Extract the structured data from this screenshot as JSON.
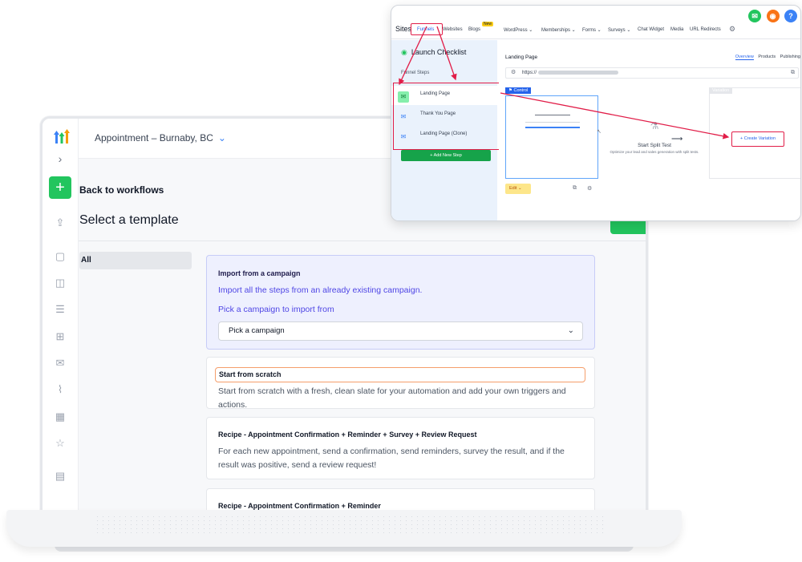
{
  "app": {
    "location": "Appointment – Burnaby, BC",
    "back_link": "Back to workflows",
    "page_title": "Select a template",
    "filter_selected": "All"
  },
  "cards": {
    "import": {
      "title": "Import from a campaign",
      "desc": "Import all the steps from an already existing campaign.",
      "pick_label": "Pick a campaign to import from",
      "select_value": "Pick a campaign"
    },
    "scratch": {
      "title": "Start from scratch",
      "desc": "Start from scratch with a fresh, clean slate for your automation and add your own triggers and actions."
    },
    "recipe1": {
      "title": "Recipe - Appointment Confirmation + Reminder + Survey + Review Request",
      "desc": "For each new appointment, send a confirmation, send reminders, survey the result, and if the result was positive, send a review request!"
    },
    "recipe2": {
      "title": "Recipe - Appointment Confirmation + Reminder"
    }
  },
  "funnels_window": {
    "nav": {
      "sites": "Sites",
      "items": [
        "Funnels",
        "Websites",
        "Blogs",
        "WordPress ⌄",
        "Memberships ⌄",
        "Forms ⌄",
        "Surveys ⌄",
        "Chat Widget",
        "Media",
        "URL Redirects"
      ],
      "new_badge": "New"
    },
    "launch_checklist": "Launch Checklist",
    "funnel_steps_label": "Funnel Steps",
    "steps": [
      "Landing Page",
      "Thank You Page",
      "Landing Page (Clone)"
    ],
    "add_step": "+ Add New Step",
    "page_title": "Landing Page",
    "tabs": [
      "Overview",
      "Products",
      "Publishing"
    ],
    "url": "https://",
    "control_label": "Control",
    "variation_label": "Variation",
    "edit_label": "Edit",
    "split_title": "Start Split Test",
    "split_desc": "Optimize your lead and sales generation with split tests.",
    "create_variation": "+ Create Variation"
  },
  "colors": {
    "accent_green": "#22c55e",
    "highlight_red": "#e11d48",
    "link_blue": "#2563eb",
    "import_purple": "#4f46e5",
    "scratch_orange": "#f59e6b"
  }
}
